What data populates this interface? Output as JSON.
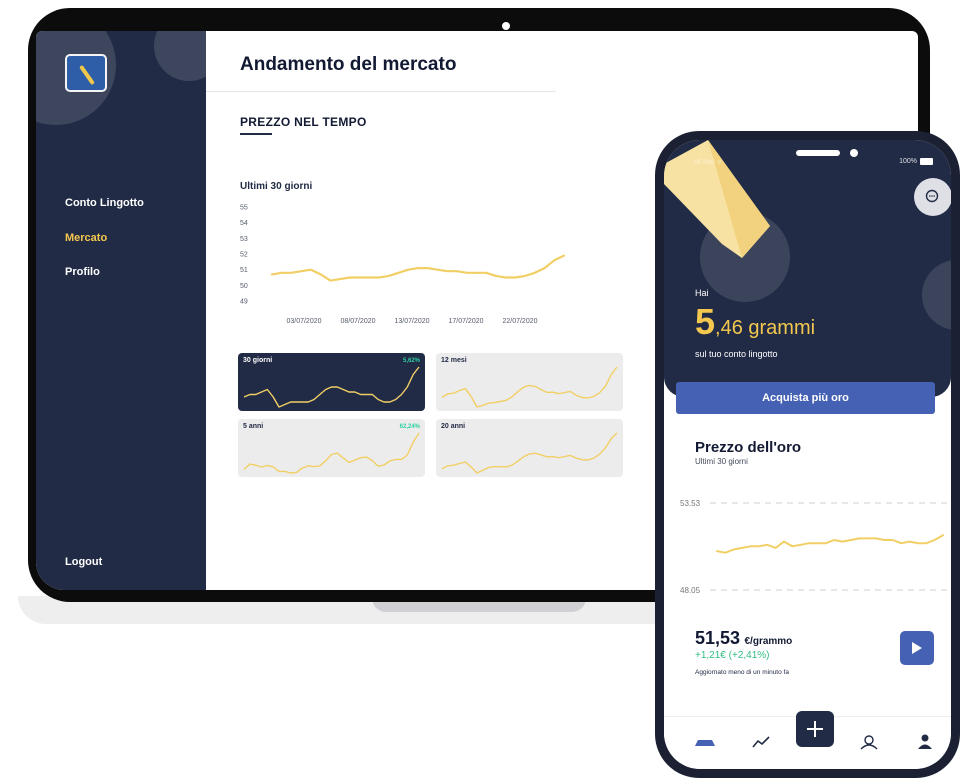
{
  "laptop": {
    "sidebar": {
      "items": [
        {
          "label": "Conto Lingotto",
          "active": false
        },
        {
          "label": "Mercato",
          "active": true
        },
        {
          "label": "Profilo",
          "active": false
        }
      ],
      "logout": "Logout"
    },
    "page_title": "Andamento del mercato",
    "section_title": "PREZZO NEL TEMPO",
    "chart_label": "Ultimi 30 giorni",
    "mini_cards": [
      {
        "label": "30 giorni",
        "pct": "5,62%",
        "active": true
      },
      {
        "label": "12 mesi",
        "pct": "",
        "active": false
      },
      {
        "label": "5 anni",
        "pct": "62,24%",
        "active": false
      },
      {
        "label": "20 anni",
        "pct": "",
        "active": false
      }
    ]
  },
  "phone": {
    "status_carrier": "ull Mai ᯤ",
    "status_battery": "100%",
    "hai": "Hai",
    "amount_int": "5",
    "amount_rest": ",46 grammi",
    "amount_sub": "sul tuo conto lingotto",
    "cta": "Acquista più oro",
    "price_title": "Prezzo dell'oro",
    "price_subtitle": "Ultimi 30 giorni",
    "ref_high": "53.53",
    "ref_low": "48.05",
    "current_price": "51,53",
    "current_unit": "€/grammo",
    "change": "+1,21€ (+2,41%)",
    "updated": "Aggiornato meno di un minuto fa"
  },
  "colors": {
    "navy": "#222b46",
    "gold": "#f4c84e",
    "accent_blue": "#4561b4",
    "green": "#2fbe82"
  },
  "chart_data": [
    {
      "type": "line",
      "ylim": [
        49,
        55
      ],
      "yticks": [
        "55",
        "54",
        "53",
        "52",
        "51",
        "50",
        "49"
      ],
      "xtick_labels": [
        "03/07/2020",
        "08/07/2020",
        "13/07/2020",
        "17/07/2020",
        "22/07/2020"
      ],
      "values": [
        50.7,
        50.8,
        50.8,
        50.9,
        51.0,
        50.7,
        50.3,
        50.4,
        50.5,
        50.5,
        50.5,
        50.5,
        50.6,
        50.8,
        51.0,
        51.1,
        51.1,
        51.0,
        50.9,
        50.9,
        50.8,
        50.8,
        50.8,
        50.6,
        50.5,
        50.5,
        50.6,
        50.8,
        51.1,
        51.6,
        51.9
      ]
    },
    {
      "type": "line",
      "ref_lines": [
        53.53,
        48.05
      ],
      "ylim": [
        47.4,
        54.2
      ],
      "values": [
        50.5,
        50.4,
        50.6,
        50.7,
        50.8,
        50.8,
        50.9,
        50.7,
        51.1,
        50.8,
        50.9,
        51.0,
        51.0,
        51.0,
        51.2,
        51.1,
        51.2,
        51.3,
        51.3,
        51.3,
        51.2,
        51.2,
        51.0,
        51.1,
        51.0,
        51.0,
        51.2,
        51.5
      ]
    }
  ]
}
